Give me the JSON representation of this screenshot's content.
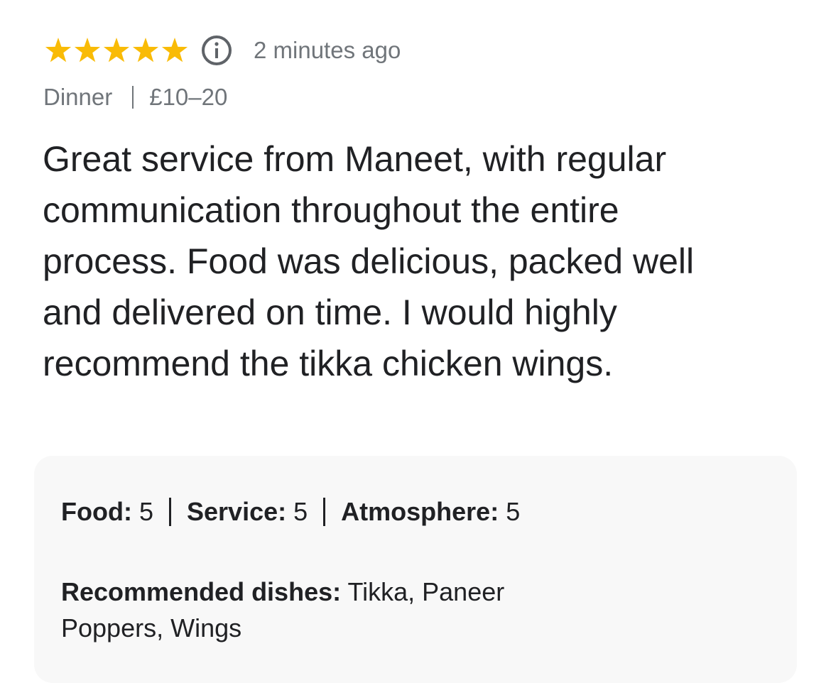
{
  "review": {
    "rating": 5,
    "rating_max": 5,
    "star_color": "#F9BB06",
    "info_icon": "info-icon",
    "time_ago": "2 minutes ago",
    "meal_type": "Dinner",
    "price_range": "£10–20",
    "text": "Great service from Maneet, with regular\ncommunication throughout the entire\nprocess. Food was delicious, packed well\nand delivered on time.  I would highly\nrecommend the tikka chicken wings."
  },
  "details": {
    "scores": [
      {
        "label": "Food:",
        "value": "5"
      },
      {
        "label": "Service:",
        "value": "5"
      },
      {
        "label": "Atmosphere:",
        "value": "5"
      }
    ],
    "recommended_label": "Recommended dishes:",
    "recommended_value": "Tikka, Paneer Poppers, Wings"
  }
}
